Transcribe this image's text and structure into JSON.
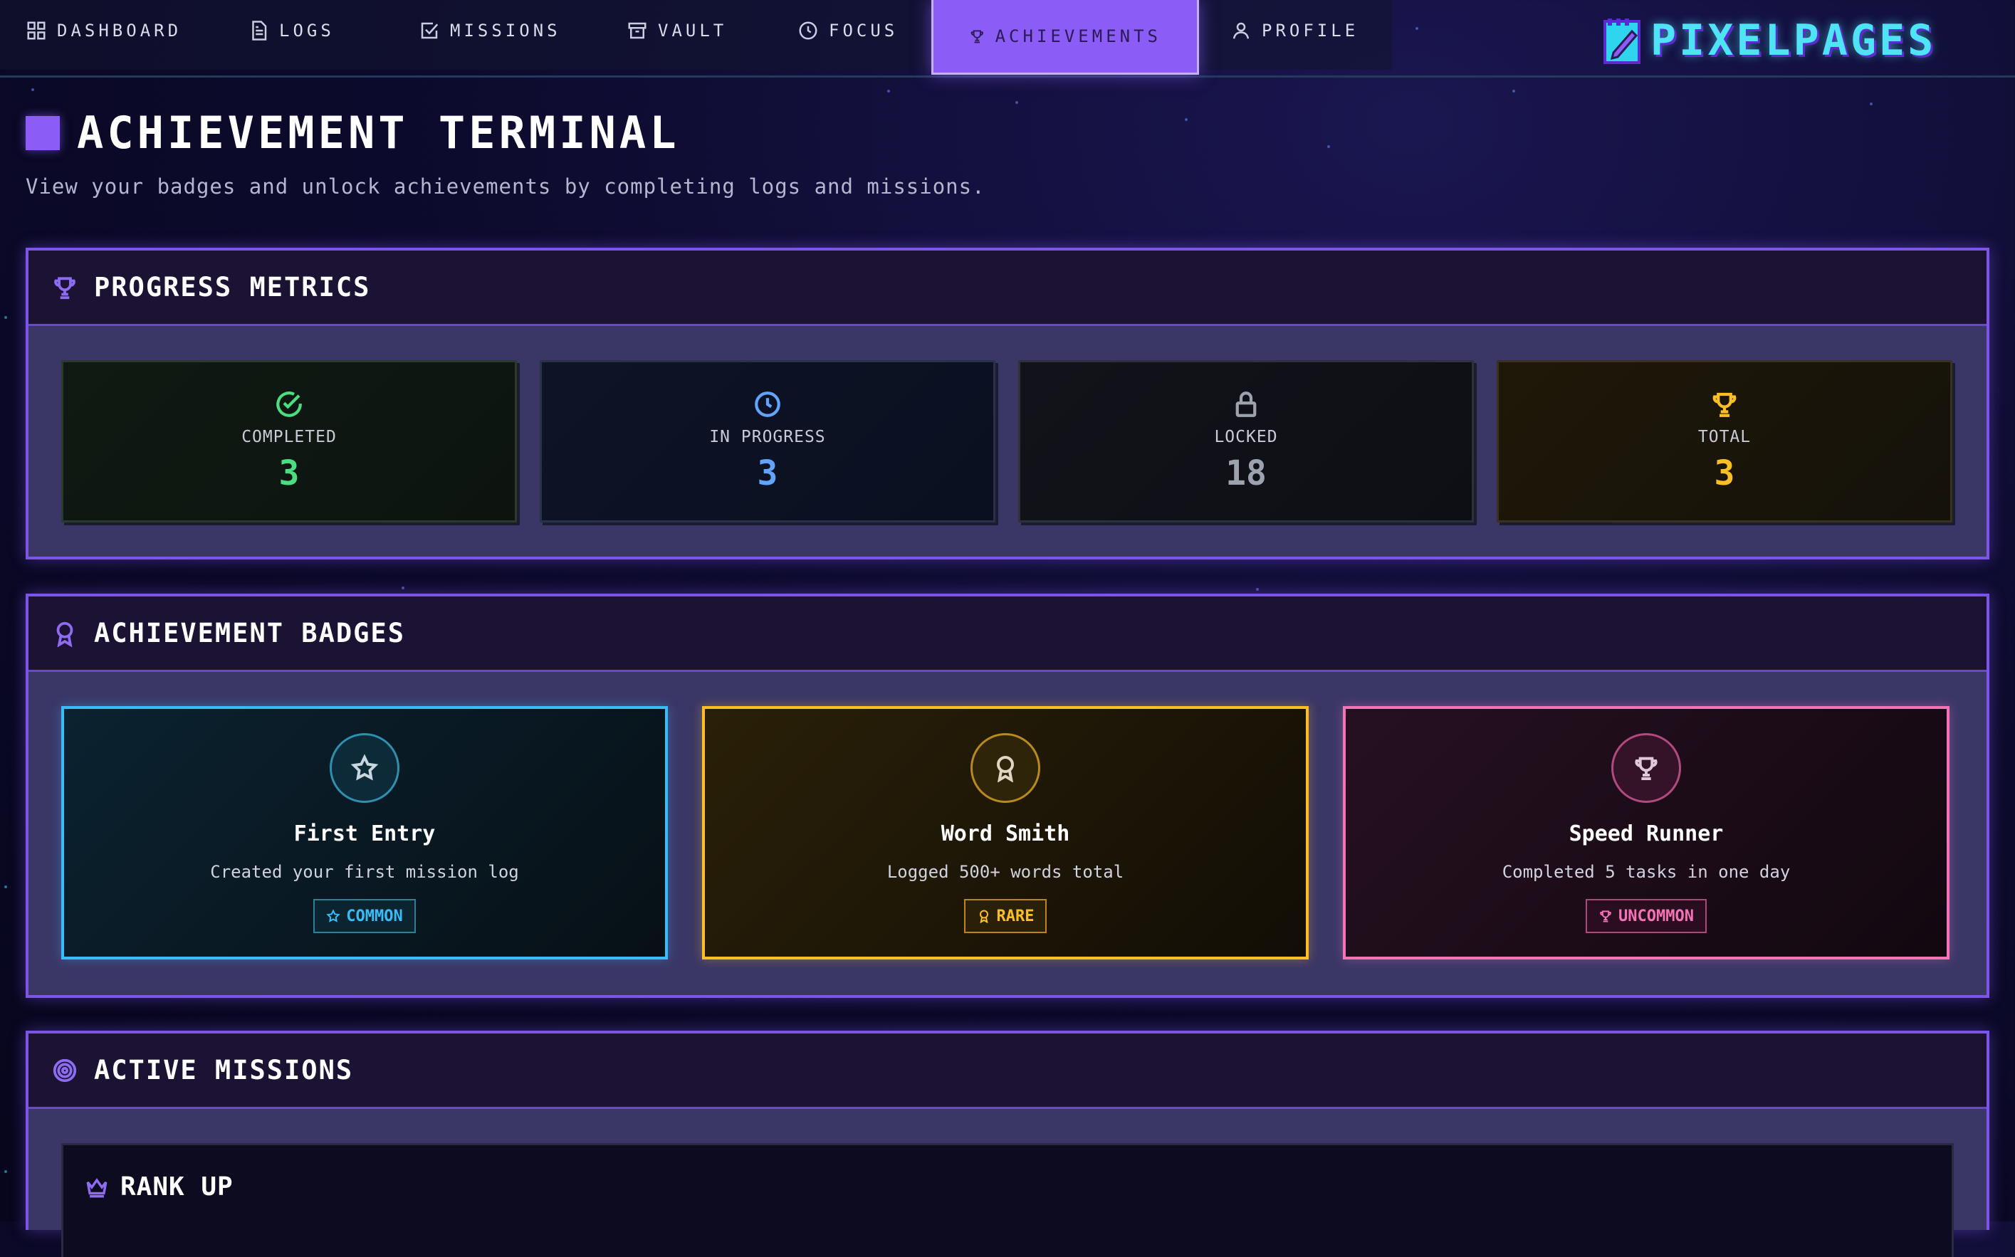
{
  "nav": {
    "tabs": [
      {
        "label": "DASHBOARD",
        "icon": "grid-icon"
      },
      {
        "label": "LOGS",
        "icon": "document-icon"
      },
      {
        "label": "MISSIONS",
        "icon": "checkbox-icon"
      },
      {
        "label": "VAULT",
        "icon": "archive-icon"
      },
      {
        "label": "FOCUS",
        "icon": "clock-icon"
      },
      {
        "label": "ACHIEVEMENTS",
        "icon": "trophy-icon",
        "active": true
      },
      {
        "label": "PROFILE",
        "icon": "user-icon"
      }
    ],
    "logo_text": "PIXELPAGES"
  },
  "header": {
    "title": "ACHIEVEMENT TERMINAL",
    "subtitle": "View your badges and unlock achievements by completing logs and missions."
  },
  "progress": {
    "title": "PROGRESS METRICS",
    "metrics": [
      {
        "label": "COMPLETED",
        "value": "3",
        "icon": "check-circle-icon",
        "color": "#4ade80"
      },
      {
        "label": "IN PROGRESS",
        "value": "3",
        "icon": "clock-icon",
        "color": "#60a5fa"
      },
      {
        "label": "LOCKED",
        "value": "18",
        "icon": "lock-icon",
        "color": "#9ca3af"
      },
      {
        "label": "TOTAL",
        "value": "3",
        "icon": "trophy-icon",
        "color": "#fbbf24"
      }
    ]
  },
  "badges": {
    "title": "ACHIEVEMENT BADGES",
    "items": [
      {
        "title": "First Entry",
        "description": "Created your first mission log",
        "rarity": "COMMON",
        "icon": "star-icon",
        "color": "#38bdf8"
      },
      {
        "title": "Word Smith",
        "description": "Logged 500+ words total",
        "rarity": "RARE",
        "icon": "award-icon",
        "color": "#fbbf24"
      },
      {
        "title": "Speed Runner",
        "description": "Completed 5 tasks in one day",
        "rarity": "UNCOMMON",
        "icon": "trophy-icon",
        "color": "#f472b6"
      }
    ]
  },
  "missions": {
    "title": "ACTIVE MISSIONS",
    "cards": [
      {
        "title": "RANK UP",
        "icon": "crown-icon"
      }
    ]
  }
}
